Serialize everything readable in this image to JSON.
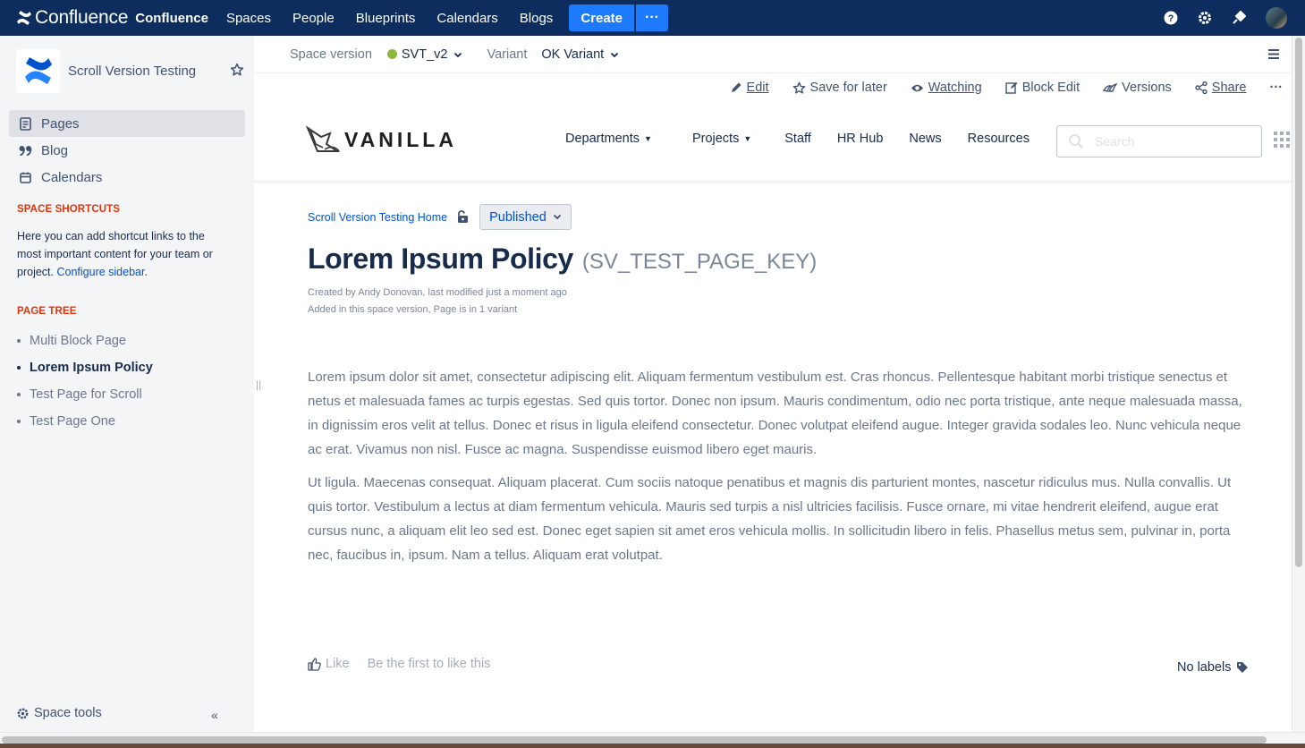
{
  "topnav": {
    "logo_text": "Confluence",
    "logo_text_bold": "Confluence",
    "items": [
      "Spaces",
      "People",
      "Blueprints",
      "Calendars",
      "Blogs"
    ],
    "create_label": "Create",
    "more_label": "···",
    "icons": [
      "help-icon",
      "gear-icon",
      "notifications-icon"
    ],
    "bg_color": "#0C2D5E",
    "accent_color": "#1D7AFC"
  },
  "sidebar": {
    "space_title": "Scroll Version Testing",
    "nav": [
      {
        "label": "Pages",
        "icon": "pages-icon",
        "active": true
      },
      {
        "label": "Blog",
        "icon": "blog-quote-icon",
        "active": false
      },
      {
        "label": "Calendars",
        "icon": "calendar-icon",
        "active": false
      }
    ],
    "shortcuts_title": "SPACE SHORTCUTS",
    "shortcuts_text": "Here you can add shortcut links to the most important content for your team or project.",
    "shortcuts_link": "Configure sidebar",
    "shortcuts_end": ".",
    "tree_title": "PAGE TREE",
    "tree": [
      {
        "label": "Multi Block Page",
        "current": false
      },
      {
        "label": "Lorem Ipsum Policy",
        "current": true
      },
      {
        "label": "Test Page for Scroll",
        "current": false
      },
      {
        "label": "Test Page One",
        "current": false
      }
    ],
    "space_tools": "Space tools",
    "collapse": "«"
  },
  "versionbar": {
    "space_version_label": "Space version",
    "space_version_value": "SVT_v2",
    "variant_label": "Variant",
    "variant_value": "OK Variant",
    "status_color": "#8BB83B"
  },
  "actions": {
    "edit": "Edit",
    "save_later": "Save for later",
    "watching": "Watching",
    "block_edit": "Block Edit",
    "versions": "Versions",
    "share": "Share",
    "more": "···"
  },
  "vanilla": {
    "brand": "VANILLA",
    "nav": [
      {
        "label": "Departments",
        "dropdown": true
      },
      {
        "label": "Projects",
        "dropdown": true
      },
      {
        "label": "Staff",
        "dropdown": false
      },
      {
        "label": "HR Hub",
        "dropdown": false
      },
      {
        "label": "News",
        "dropdown": false
      },
      {
        "label": "Resources",
        "dropdown": false
      }
    ],
    "search_placeholder": "Search"
  },
  "page": {
    "breadcrumb": "Scroll Version Testing Home",
    "status": "Published",
    "title": "Lorem Ipsum Policy",
    "key": "(SV_TEST_PAGE_KEY)",
    "meta_line1": "Created by Andy Donovan, last modified just a moment ago",
    "meta_line2": "Added in this space version, Page is in 1 variant",
    "paragraphs": [
      "Lorem ipsum dolor sit amet, consectetur adipiscing elit. Aliquam fermentum vestibulum est. Cras rhoncus. Pellentesque habitant morbi tristique senectus et netus et malesuada fames ac turpis egestas. Sed quis tortor. Donec non ipsum. Mauris condimentum, odio nec porta tristique, ante neque malesuada massa, in dignissim eros velit at tellus. Donec et risus in ligula eleifend consectetur. Donec volutpat eleifend augue. Integer gravida sodales leo. Nunc vehicula neque ac erat. Vivamus non nisl. Fusce ac magna. Suspendisse euismod libero eget mauris.",
      "Ut ligula. Maecenas consequat. Aliquam placerat. Cum sociis natoque penatibus et magnis dis parturient montes, nascetur ridiculus mus. Nulla convallis. Ut quis tortor. Vestibulum a lectus at diam fermentum vehicula. Mauris sed turpis a nisl ultricies facilisis. Fusce ornare, mi vitae hendrerit eleifend, augue erat cursus nunc, a aliquam elit leo sed est. Donec eget sapien sit amet eros vehicula mollis. In sollicitudin libero in felis. Phasellus metus sem, pulvinar in, porta nec, faucibus in, ipsum. Nam a tellus. Aliquam erat volutpat."
    ],
    "like": "Like",
    "like_first": "Be the first to like this",
    "labels": "No labels"
  }
}
